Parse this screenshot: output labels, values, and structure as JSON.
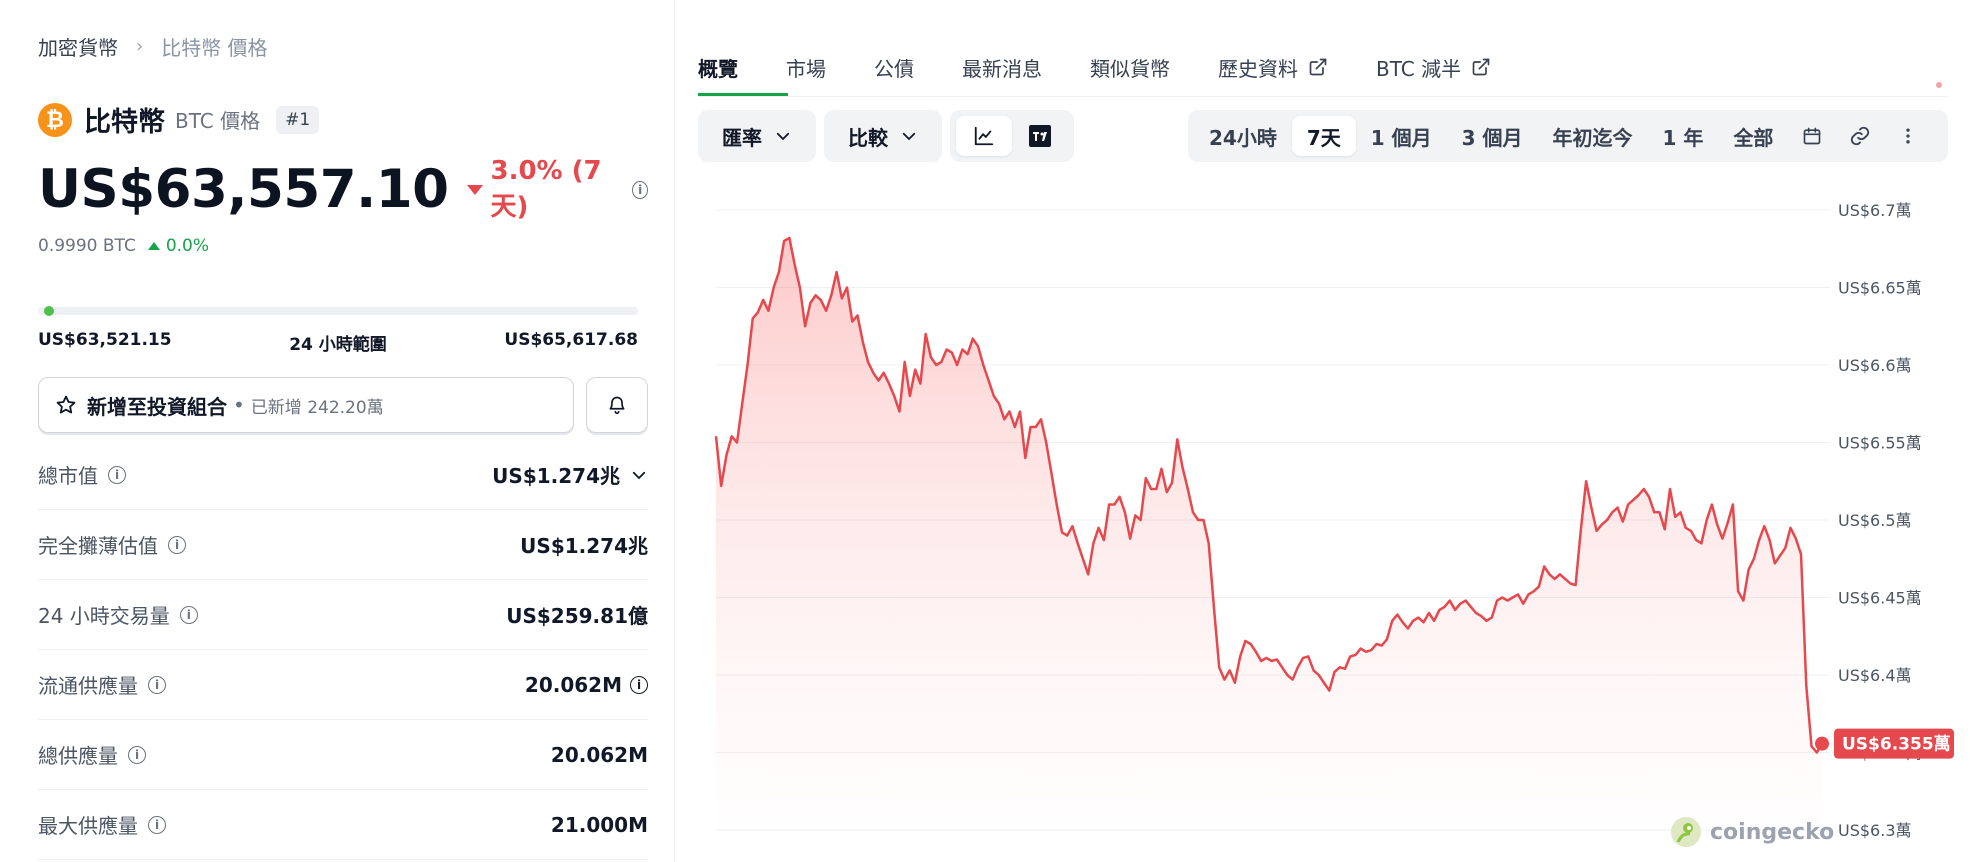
{
  "breadcrumb": {
    "parent": "加密貨幣",
    "current": "比特幣 價格"
  },
  "coin": {
    "name": "比特幣",
    "subtitle": "BTC 價格",
    "rank": "#1",
    "price": "US$63,557.10",
    "change": "3.0% (7天)",
    "btc_value": "0.9990 BTC",
    "btc_change": "0.0%"
  },
  "range24h": {
    "low": "US$63,521.15",
    "label": "24 小時範圍",
    "high": "US$65,617.68",
    "position": 0.01
  },
  "portfolio": {
    "label": "新增至投資組合",
    "count": "已新增 242.20萬"
  },
  "stats": [
    {
      "label": "總市值",
      "value": "US$1.274兆"
    },
    {
      "label": "完全攤薄估值",
      "value": "US$1.274兆"
    },
    {
      "label": "24 小時交易量",
      "value": "US$259.81億"
    },
    {
      "label": "流通供應量",
      "value": "20.062M"
    },
    {
      "label": "總供應量",
      "value": "20.062M"
    },
    {
      "label": "最大供應量",
      "value": "21.000M"
    }
  ],
  "tabs": [
    "概覽",
    "市場",
    "公債",
    "最新消息",
    "類似貨幣",
    "歷史資料",
    "BTC 減半"
  ],
  "toolbar": {
    "rate": "匯率",
    "compare": "比較"
  },
  "ranges": [
    "24小時",
    "7天",
    "1 個月",
    "3 個月",
    "年初迄今",
    "1 年",
    "全部"
  ],
  "selected_range": "7天",
  "watermark": "coingecko",
  "colors": {
    "accent": "#16a34a",
    "down": "#e5484d",
    "up": "#16a34a",
    "btc": "#f7931a"
  },
  "chart_data": {
    "type": "area",
    "ylim": [
      63000,
      67000
    ],
    "yticks": [
      {
        "value": 67000,
        "label": "US$6.7萬"
      },
      {
        "value": 66500,
        "label": "US$6.65萬"
      },
      {
        "value": 66000,
        "label": "US$6.6萬"
      },
      {
        "value": 65500,
        "label": "US$6.55萬"
      },
      {
        "value": 65000,
        "label": "US$6.5萬"
      },
      {
        "value": 64500,
        "label": "US$6.45萬"
      },
      {
        "value": 64000,
        "label": "US$6.4萬"
      },
      {
        "value": 63500,
        "label": "US$6.35萬"
      },
      {
        "value": 63000,
        "label": "US$6.3萬"
      }
    ],
    "last_label": "US$6.355萬",
    "values": [
      65540,
      65220,
      65420,
      65540,
      65500,
      65750,
      66000,
      66300,
      66340,
      66420,
      66350,
      66500,
      66600,
      66800,
      66820,
      66650,
      66500,
      66250,
      66400,
      66450,
      66420,
      66350,
      66450,
      66600,
      66430,
      66500,
      66280,
      66320,
      66150,
      66020,
      65950,
      65900,
      65950,
      65880,
      65800,
      65700,
      66020,
      65800,
      65970,
      65880,
      66200,
      66050,
      66000,
      66020,
      66100,
      66080,
      66000,
      66100,
      66070,
      66170,
      66120,
      66000,
      65900,
      65800,
      65750,
      65650,
      65700,
      65600,
      65700,
      65400,
      65600,
      65600,
      65650,
      65500,
      65300,
      65100,
      64920,
      64900,
      64960,
      64850,
      64750,
      64650,
      64850,
      64950,
      64870,
      65100,
      65100,
      65150,
      65050,
      64880,
      65030,
      65000,
      65270,
      65200,
      65200,
      65330,
      65180,
      65240,
      65520,
      65340,
      65200,
      65050,
      65000,
      65000,
      64850,
      64430,
      64050,
      63970,
      64030,
      63950,
      64120,
      64220,
      64200,
      64150,
      64090,
      64110,
      64090,
      64100,
      64050,
      64000,
      63970,
      64050,
      64110,
      64120,
      64030,
      64000,
      63950,
      63900,
      64020,
      64050,
      64040,
      64120,
      64130,
      64170,
      64150,
      64160,
      64200,
      64190,
      64230,
      64350,
      64390,
      64340,
      64300,
      64350,
      64370,
      64340,
      64400,
      64350,
      64420,
      64440,
      64480,
      64420,
      64460,
      64480,
      64440,
      64400,
      64380,
      64350,
      64370,
      64480,
      64500,
      64480,
      64500,
      64520,
      64460,
      64520,
      64540,
      64570,
      64700,
      64650,
      64620,
      64650,
      64620,
      64590,
      64580,
      64940,
      65250,
      65080,
      64930,
      64970,
      65000,
      65050,
      65080,
      64990,
      65100,
      65130,
      65160,
      65200,
      65150,
      65050,
      65050,
      64940,
      65200,
      65020,
      65050,
      64950,
      64930,
      64870,
      64850,
      65000,
      65100,
      64970,
      64880,
      64980,
      65100,
      64540,
      64480,
      64680,
      64750,
      64870,
      64960,
      64870,
      64720,
      64770,
      64820,
      64950,
      64880,
      64780,
      63930,
      63540,
      63500,
      63557
    ]
  }
}
